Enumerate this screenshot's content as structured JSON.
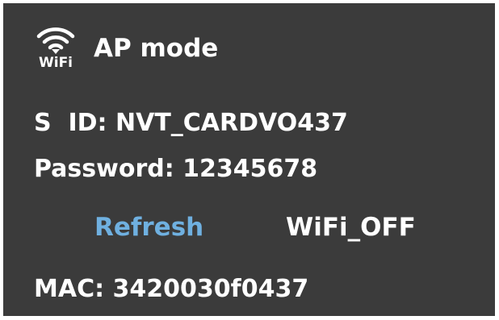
{
  "colors": {
    "background": "#3b3b3b",
    "text": "#ffffff",
    "accent": "#6fb0e0"
  },
  "header": {
    "icon": "wifi-icon",
    "icon_text": "WiFi",
    "title": "AP mode"
  },
  "info": {
    "ssid": "S  ID: NVT_CARDVO437",
    "password": "Password: 12345678",
    "mac": "MAC: 3420030f0437"
  },
  "actions": {
    "refresh_label": "Refresh",
    "wifi_off_label": "WiFi_OFF"
  }
}
